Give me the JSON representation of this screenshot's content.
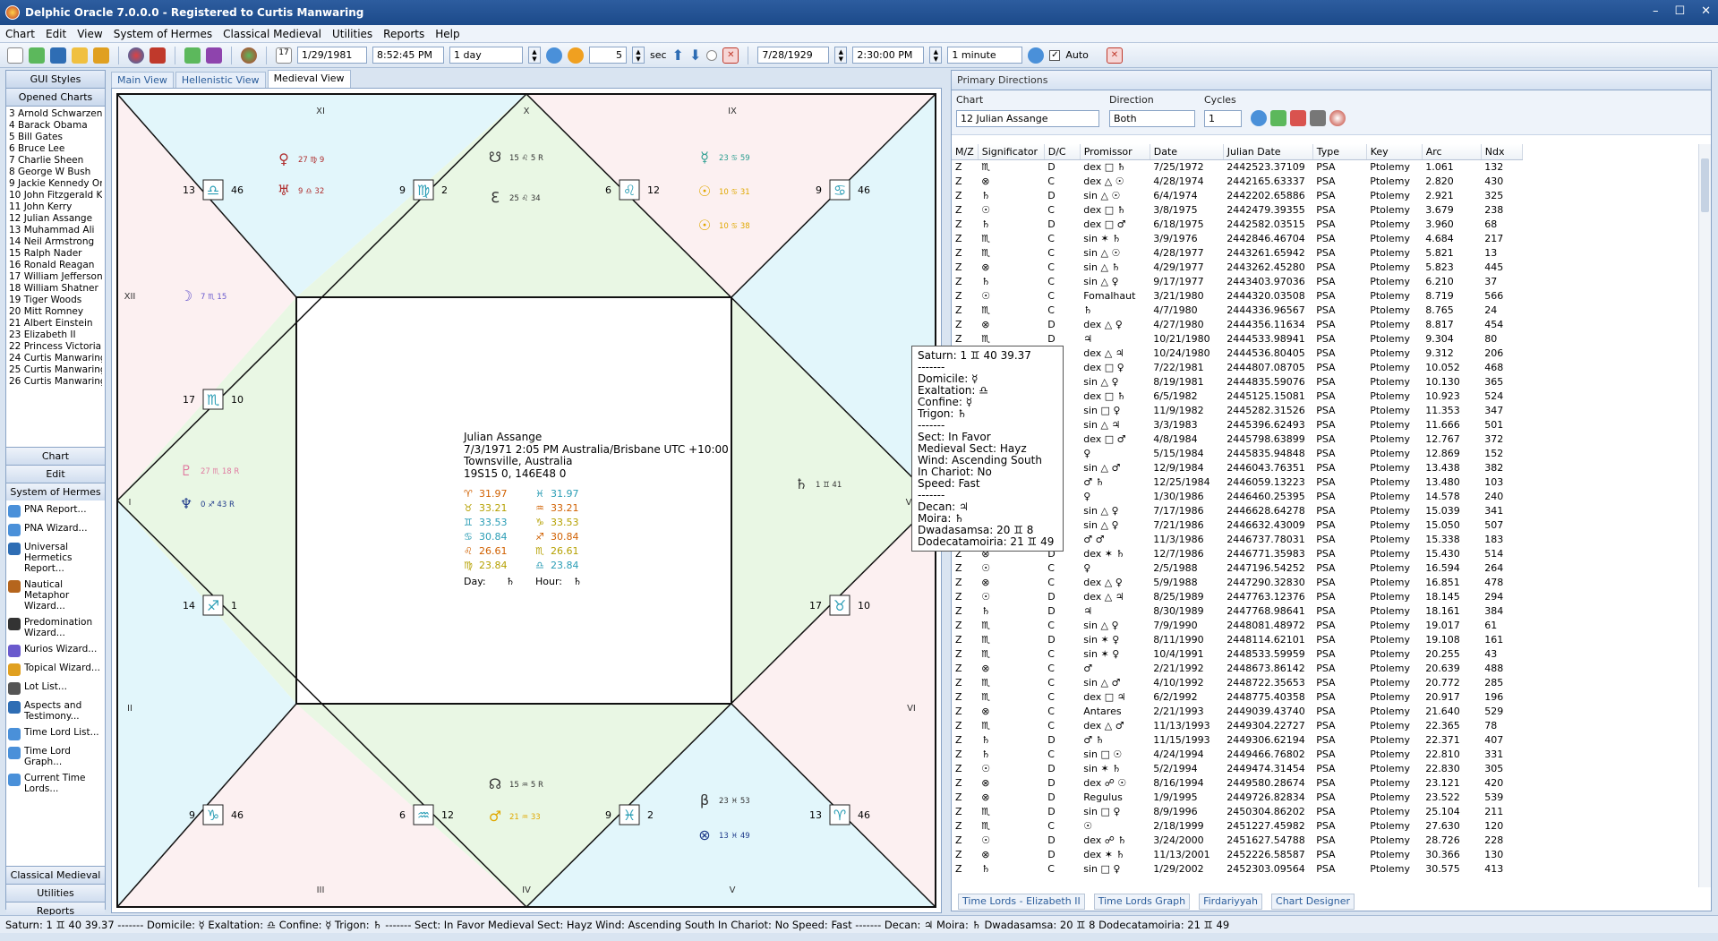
{
  "window": {
    "title": "Delphic Oracle 7.0.0.0 - Registered to Curtis Manwaring"
  },
  "menu": [
    "Chart",
    "Edit",
    "View",
    "System of Hermes",
    "Classical Medieval",
    "Utilities",
    "Reports",
    "Help"
  ],
  "toolbar": {
    "date1": "1/29/1981",
    "time1": "8:52:45 PM",
    "step1": "1 day",
    "sec_value": "5",
    "sec_label": "sec",
    "date2": "7/28/1929",
    "time2": "2:30:00 PM",
    "step2": "1 minute",
    "auto_label": "Auto"
  },
  "left": {
    "gui_styles": "GUI Styles",
    "opened_charts": "Opened Charts",
    "charts": [
      "3 Arnold Schwarzeneg",
      "4 Barack Obama",
      "5 Bill Gates",
      "6 Bruce Lee",
      "7 Charlie Sheen",
      "8 George W Bush",
      "9 Jackie Kennedy Ona",
      "10 John Fitzgerald Ker",
      "11 John Kerry",
      "12 Julian Assange",
      "13 Muhammad Ali",
      "14 Neil Armstrong",
      "15 Ralph Nader",
      "16 Ronald Reagan",
      "17 William Jefferson C",
      "18 William Shatner",
      "19 Tiger Woods",
      "20 Mitt Romney",
      "21 Albert Einstein",
      "23 Elizabeth II",
      "22 Princess Victoria",
      "24 Curtis Manwaring",
      "25 Curtis Manwaring L",
      "26 Curtis Manwaring L"
    ],
    "nav_chart": "Chart",
    "nav_edit": "Edit",
    "nav_hermes": "System of Hermes",
    "hermes_items": [
      "PNA Report...",
      "PNA Wizard...",
      "Universal Hermetics Report...",
      "Nautical Metaphor Wizard...",
      "Predomination Wizard...",
      "Kurios Wizard...",
      "Topical Wizard...",
      "Lot List...",
      "Aspects and Testimony...",
      "Time Lord List...",
      "Time Lord Graph...",
      "Current Time Lords..."
    ],
    "nav_classical": "Classical Medieval",
    "nav_utilities": "Utilities",
    "nav_reports": "Reports"
  },
  "tabs": [
    "Main View",
    "Hellenistic View",
    "Medieval View"
  ],
  "chart": {
    "center": {
      "name": "Julian Assange",
      "line1": "7/3/1971  2:05 PM  Australia/Brisbane UTC +10:00",
      "line2": "Townsville, Australia",
      "line3": "19S15 0,  146E48 0",
      "deg_left": [
        {
          "g": "♈",
          "v": "31.97"
        },
        {
          "g": "♉",
          "v": "33.21"
        },
        {
          "g": "♊",
          "v": "33.53"
        },
        {
          "g": "♋",
          "v": "30.84"
        },
        {
          "g": "♌",
          "v": "26.61"
        },
        {
          "g": "♍",
          "v": "23.84"
        }
      ],
      "deg_right": [
        {
          "g": "♓",
          "v": "31.97"
        },
        {
          "g": "♒",
          "v": "33.21"
        },
        {
          "g": "♑",
          "v": "33.53"
        },
        {
          "g": "♐",
          "v": "30.84"
        },
        {
          "g": "♏",
          "v": "26.61"
        },
        {
          "g": "♎",
          "v": "23.84"
        }
      ],
      "day_label": "Day:",
      "day_val": "♄",
      "hour_label": "Hour:",
      "hour_val": "♄"
    },
    "houses": [
      "XI",
      "X",
      "IX",
      "XII",
      "I",
      "II",
      "III",
      "IV",
      "V",
      "VI",
      "VII"
    ],
    "cusps": [
      {
        "l": "13",
        "g": "♎",
        "r": "46"
      },
      {
        "l": "9",
        "g": "♍",
        "r": "2"
      },
      {
        "l": "6",
        "g": "♌",
        "r": "12"
      },
      {
        "l": "9",
        "g": "♋",
        "r": "46"
      },
      {
        "l": "17",
        "g": "♏",
        "r": "10"
      },
      {
        "l": "14",
        "g": "♐",
        "r": "1"
      },
      {
        "l": "17",
        "g": "♉",
        "r": "10"
      },
      {
        "l": "9",
        "g": "♑",
        "r": "46"
      },
      {
        "l": "6",
        "g": "♒",
        "r": "12"
      },
      {
        "l": "9",
        "g": "♓",
        "r": "2"
      },
      {
        "l": "13",
        "g": "♈",
        "r": "46"
      }
    ],
    "planets": [
      {
        "g": "♀",
        "t": "27 ♍ 9",
        "c": "#b03030"
      },
      {
        "g": "♅",
        "t": "9 ♎ 32",
        "c": "#b03030"
      },
      {
        "g": "☋",
        "t": "15 ♌ 5 R",
        "c": "#333"
      },
      {
        "g": "ℇ",
        "t": "25 ♌ 34",
        "c": "#333"
      },
      {
        "g": "☿",
        "t": "23 ♋ 59",
        "c": "#2a9d8f"
      },
      {
        "g": "☉",
        "t": "10 ♋ 31",
        "c": "#e0a800"
      },
      {
        "g": "☉",
        "t": "10 ♋ 38",
        "c": "#e0a800"
      },
      {
        "g": "☽",
        "t": "7 ♏ 15",
        "c": "#6a5acd"
      },
      {
        "g": "♇",
        "t": "27 ♏ 18 R",
        "c": "#e07aa0"
      },
      {
        "g": "♆",
        "t": "0 ♐ 43 R",
        "c": "#1e3a8a"
      },
      {
        "g": "♄",
        "t": "1 ♊ 41",
        "c": "#333"
      },
      {
        "g": "☊",
        "t": "15 ♒ 5 R",
        "c": "#333"
      },
      {
        "g": "♂",
        "t": "21 ♒ 33",
        "c": "#e0a800"
      },
      {
        "g": "β",
        "t": "23 ♓ 53",
        "c": "#333"
      },
      {
        "g": "⊗",
        "t": "13 ♓ 49",
        "c": "#1e3a8a"
      }
    ]
  },
  "tooltip": [
    "Saturn: 1 ♊ 40 39.37",
    "-------",
    "Domicile: ☿",
    "Exaltation: ♎",
    "Confine: ☿",
    "Trigon: ♄",
    "-------",
    "Sect: In Favor",
    "Medieval Sect: Hayz",
    "Wind: Ascending South",
    "In Chariot: No",
    "Speed: Fast",
    "-------",
    "Decan: ♃",
    "Moira: ♄",
    "Dwadasamsa: 20 ♊ 8",
    "Dodecatamoiria: 21 ♊ 49"
  ],
  "primary": {
    "panel_title": "Primary Directions",
    "chart_label": "Chart",
    "chart_value": "12 Julian Assange",
    "direction_label": "Direction",
    "direction_value": "Both",
    "cycles_label": "Cycles",
    "cycles_value": "1",
    "columns": [
      "M/Z",
      "Significator",
      "D/C",
      "Promissor",
      "Date",
      "Julian Date",
      "Type",
      "Key",
      "Arc",
      "Ndx"
    ],
    "rows": [
      [
        "Z",
        "♏",
        "D",
        "dex □ ♄",
        "7/25/1972",
        "2442523.37109",
        "PSA",
        "Ptolemy",
        "1.061",
        "132"
      ],
      [
        "Z",
        "⊗",
        "C",
        "dex △ ☉",
        "4/28/1974",
        "2442165.63337",
        "PSA",
        "Ptolemy",
        "2.820",
        "430"
      ],
      [
        "Z",
        "♄",
        "D",
        "sin △ ☉",
        "6/4/1974",
        "2442202.65886",
        "PSA",
        "Ptolemy",
        "2.921",
        "325"
      ],
      [
        "Z",
        "☉",
        "C",
        "dex □ ♄",
        "3/8/1975",
        "2442479.39355",
        "PSA",
        "Ptolemy",
        "3.679",
        "238"
      ],
      [
        "Z",
        "♄",
        "D",
        "dex □ ♂",
        "6/18/1975",
        "2442582.03515",
        "PSA",
        "Ptolemy",
        "3.960",
        "68"
      ],
      [
        "Z",
        "♏",
        "C",
        "sin ✶ ♄",
        "3/9/1976",
        "2442846.46704",
        "PSA",
        "Ptolemy",
        "4.684",
        "217"
      ],
      [
        "Z",
        "♏",
        "C",
        "sin △ ☉",
        "4/28/1977",
        "2443261.65942",
        "PSA",
        "Ptolemy",
        "5.821",
        "13"
      ],
      [
        "Z",
        "⊗",
        "C",
        "sin △ ♄",
        "4/29/1977",
        "2443262.45280",
        "PSA",
        "Ptolemy",
        "5.823",
        "445"
      ],
      [
        "Z",
        "♄",
        "C",
        "sin △ ♀",
        "9/17/1977",
        "2443403.97036",
        "PSA",
        "Ptolemy",
        "6.210",
        "37"
      ],
      [
        "Z",
        "☉",
        "C",
        "Fomalhaut",
        "3/21/1980",
        "2444320.03508",
        "PSA",
        "Ptolemy",
        "8.719",
        "566"
      ],
      [
        "Z",
        "♏",
        "C",
        "♄",
        "4/7/1980",
        "2444336.96567",
        "PSA",
        "Ptolemy",
        "8.765",
        "24"
      ],
      [
        "Z",
        "⊗",
        "D",
        "dex △ ♀",
        "4/27/1980",
        "2444356.11634",
        "PSA",
        "Ptolemy",
        "8.817",
        "454"
      ],
      [
        "Z",
        "♏",
        "D",
        "♃",
        "10/21/1980",
        "2444533.98941",
        "PSA",
        "Ptolemy",
        "9.304",
        "80"
      ],
      [
        "Z",
        "♏",
        "C",
        "dex △ ♃",
        "10/24/1980",
        "2444536.80405",
        "PSA",
        "Ptolemy",
        "9.312",
        "206"
      ],
      [
        "Z",
        "⊗",
        "D",
        "dex □ ♀",
        "7/22/1981",
        "2444807.08705",
        "PSA",
        "Ptolemy",
        "10.052",
        "468"
      ],
      [
        "Z",
        "♄",
        "C",
        "sin △ ♀",
        "8/19/1981",
        "2444835.59076",
        "PSA",
        "Ptolemy",
        "10.130",
        "365"
      ],
      [
        "Z",
        "⊗",
        "C",
        "dex □ ♄",
        "6/5/1982",
        "2445125.15081",
        "PSA",
        "Ptolemy",
        "10.923",
        "524"
      ],
      [
        "Z",
        "♏",
        "C",
        "sin □ ♀",
        "11/9/1982",
        "2445282.31526",
        "PSA",
        "Ptolemy",
        "11.353",
        "347"
      ],
      [
        "Z",
        "⊗",
        "D",
        "sin △ ♃",
        "3/3/1983",
        "2445396.62493",
        "PSA",
        "Ptolemy",
        "11.666",
        "501"
      ],
      [
        "Z",
        "♄",
        "D",
        "dex □ ♂",
        "4/8/1984",
        "2445798.63899",
        "PSA",
        "Ptolemy",
        "12.767",
        "372"
      ],
      [
        "Z",
        "♏",
        "C",
        "♀",
        "5/15/1984",
        "2445835.94848",
        "PSA",
        "Ptolemy",
        "12.869",
        "152"
      ],
      [
        "Z",
        "♄",
        "C",
        "sin △ ♂",
        "12/9/1984",
        "2446043.76351",
        "PSA",
        "Ptolemy",
        "13.438",
        "382"
      ],
      [
        "Z",
        "♏",
        "C",
        "♂ ♄",
        "12/25/1984",
        "2446059.13223",
        "PSA",
        "Ptolemy",
        "13.480",
        "103"
      ],
      [
        "Z",
        "☉",
        "D",
        "♀",
        "1/30/1986",
        "2446460.25395",
        "PSA",
        "Ptolemy",
        "14.578",
        "240"
      ],
      [
        "Z",
        "⊗",
        "D",
        "sin △ ♀",
        "7/17/1986",
        "2446628.64278",
        "PSA",
        "Ptolemy",
        "15.039",
        "341"
      ],
      [
        "Z",
        "☉",
        "C",
        "sin △ ♀",
        "7/21/1986",
        "2446632.43009",
        "PSA",
        "Ptolemy",
        "15.050",
        "507"
      ],
      [
        "Z",
        "♏",
        "D",
        "♂ ♂",
        "11/3/1986",
        "2446737.78031",
        "PSA",
        "Ptolemy",
        "15.338",
        "183"
      ],
      [
        "Z",
        "⊗",
        "D",
        "dex ✶ ♄",
        "12/7/1986",
        "2446771.35983",
        "PSA",
        "Ptolemy",
        "15.430",
        "514"
      ],
      [
        "Z",
        "☉",
        "C",
        "♀",
        "2/5/1988",
        "2447196.54252",
        "PSA",
        "Ptolemy",
        "16.594",
        "264"
      ],
      [
        "Z",
        "⊗",
        "C",
        "dex △ ♀",
        "5/9/1988",
        "2447290.32830",
        "PSA",
        "Ptolemy",
        "16.851",
        "478"
      ],
      [
        "Z",
        "☉",
        "D",
        "dex △ ♃",
        "8/25/1989",
        "2447763.12376",
        "PSA",
        "Ptolemy",
        "18.145",
        "294"
      ],
      [
        "Z",
        "♄",
        "D",
        "♃",
        "8/30/1989",
        "2447768.98641",
        "PSA",
        "Ptolemy",
        "18.161",
        "384"
      ],
      [
        "Z",
        "♏",
        "C",
        "sin △ ♀",
        "7/9/1990",
        "2448081.48972",
        "PSA",
        "Ptolemy",
        "19.017",
        "61"
      ],
      [
        "Z",
        "♏",
        "D",
        "sin ✶ ♀",
        "8/11/1990",
        "2448114.62101",
        "PSA",
        "Ptolemy",
        "19.108",
        "161"
      ],
      [
        "Z",
        "♏",
        "C",
        "sin ✶ ♀",
        "10/4/1991",
        "2448533.59959",
        "PSA",
        "Ptolemy",
        "20.255",
        "43"
      ],
      [
        "Z",
        "⊗",
        "C",
        "♂",
        "2/21/1992",
        "2448673.86142",
        "PSA",
        "Ptolemy",
        "20.639",
        "488"
      ],
      [
        "Z",
        "♏",
        "C",
        "sin △ ♂",
        "4/10/1992",
        "2448722.35653",
        "PSA",
        "Ptolemy",
        "20.772",
        "285"
      ],
      [
        "Z",
        "♏",
        "C",
        "dex □ ♃",
        "6/2/1992",
        "2448775.40358",
        "PSA",
        "Ptolemy",
        "20.917",
        "196"
      ],
      [
        "Z",
        "⊗",
        "C",
        "Antares",
        "2/21/1993",
        "2449039.43740",
        "PSA",
        "Ptolemy",
        "21.640",
        "529"
      ],
      [
        "Z",
        "♏",
        "C",
        "dex △ ♂",
        "11/13/1993",
        "2449304.22727",
        "PSA",
        "Ptolemy",
        "22.365",
        "78"
      ],
      [
        "Z",
        "♄",
        "D",
        "♂ ♄",
        "11/15/1993",
        "2449306.62194",
        "PSA",
        "Ptolemy",
        "22.371",
        "407"
      ],
      [
        "Z",
        "♄",
        "C",
        "sin □ ☉",
        "4/24/1994",
        "2449466.76802",
        "PSA",
        "Ptolemy",
        "22.810",
        "331"
      ],
      [
        "Z",
        "☉",
        "D",
        "sin ✶ ♄",
        "5/2/1994",
        "2449474.31454",
        "PSA",
        "Ptolemy",
        "22.830",
        "305"
      ],
      [
        "Z",
        "⊗",
        "D",
        "dex ☍ ☉",
        "8/16/1994",
        "2449580.28674",
        "PSA",
        "Ptolemy",
        "23.121",
        "420"
      ],
      [
        "Z",
        "⊗",
        "D",
        "Regulus",
        "1/9/1995",
        "2449726.82834",
        "PSA",
        "Ptolemy",
        "23.522",
        "539"
      ],
      [
        "Z",
        "♏",
        "D",
        "sin □ ♀",
        "8/9/1996",
        "2450304.86202",
        "PSA",
        "Ptolemy",
        "25.104",
        "211"
      ],
      [
        "Z",
        "♏",
        "C",
        "☉",
        "2/18/1999",
        "2451227.45982",
        "PSA",
        "Ptolemy",
        "27.630",
        "120"
      ],
      [
        "Z",
        "☉",
        "D",
        "dex ☍ ♄",
        "3/24/2000",
        "2451627.54788",
        "PSA",
        "Ptolemy",
        "28.726",
        "228"
      ],
      [
        "Z",
        "⊗",
        "D",
        "dex ✶ ♄",
        "11/13/2001",
        "2452226.58587",
        "PSA",
        "Ptolemy",
        "30.366",
        "130"
      ],
      [
        "Z",
        "♄",
        "C",
        "sin □ ♀",
        "1/29/2002",
        "2452303.09564",
        "PSA",
        "Ptolemy",
        "30.575",
        "413"
      ]
    ]
  },
  "bottom_tabs": [
    "Time Lords - Elizabeth II",
    "Time Lords Graph",
    "Firdariyyah",
    "Chart Designer"
  ],
  "status": "Saturn: 1 ♊ 40 39.37 ------- Domicile: ☿ Exaltation: ♎ Confine: ☿ Trigon: ♄ ------- Sect: In Favor Medieval Sect: Hayz Wind: Ascending South In Chariot: No Speed: Fast ------- Decan: ♃ Moira: ♄ Dwadasamsa: 20 ♊ 8 Dodecatamoiria: 21 ♊ 49"
}
